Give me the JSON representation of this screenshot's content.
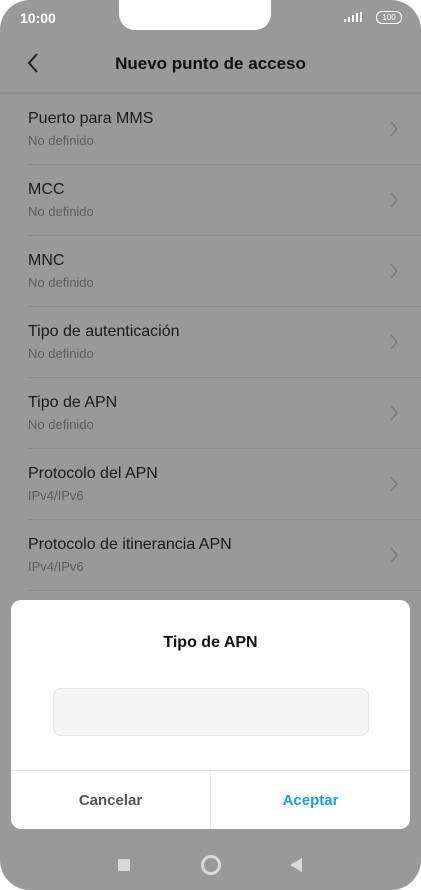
{
  "status": {
    "time": "10:00",
    "battery": "100"
  },
  "header": {
    "title": "Nuevo punto de acceso"
  },
  "list": [
    {
      "title": "Puerto para MMS",
      "subtitle": "No definido"
    },
    {
      "title": "MCC",
      "subtitle": "No definido"
    },
    {
      "title": "MNC",
      "subtitle": "No definido"
    },
    {
      "title": "Tipo de autenticación",
      "subtitle": "No definido"
    },
    {
      "title": "Tipo de APN",
      "subtitle": "No definido"
    },
    {
      "title": "Protocolo del APN",
      "subtitle": "IPv4/IPv6"
    },
    {
      "title": "Protocolo de itinerancia APN",
      "subtitle": "IPv4/IPv6"
    }
  ],
  "dialog": {
    "title": "Tipo de APN",
    "input_value": "",
    "cancel_label": "Cancelar",
    "ok_label": "Aceptar"
  },
  "colors": {
    "accent": "#1c9be6",
    "scrim": "#999999"
  }
}
